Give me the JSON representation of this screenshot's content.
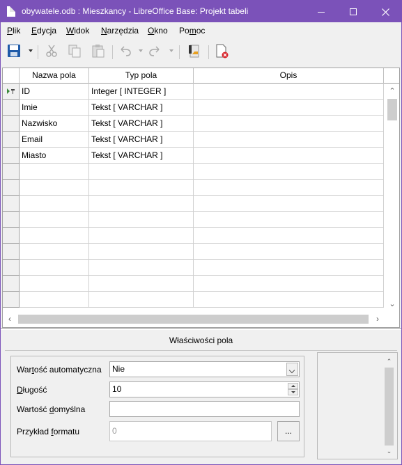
{
  "window": {
    "title": "obywatele.odb : Mieszkancy - LibreOffice Base: Projekt tabeli",
    "accent_color": "#7b52b9"
  },
  "menu": [
    {
      "label": "Plik",
      "ul": "P",
      "rest": "lik"
    },
    {
      "label": "Edycja",
      "ul": "E",
      "rest": "dycja"
    },
    {
      "label": "Widok",
      "ul": "W",
      "rest": "idok"
    },
    {
      "label": "Narzędzia",
      "ul": "N",
      "rest": "arzędzia"
    },
    {
      "label": "Okno",
      "ul": "O",
      "rest": "kno"
    },
    {
      "label": "Pomoc",
      "pre": "Po",
      "ul": "m",
      "rest": "oc"
    }
  ],
  "toolbar": {
    "icons": [
      "save-icon",
      "cut-icon",
      "copy-icon",
      "paste-icon",
      "undo-icon",
      "redo-icon",
      "primary-key-icon",
      "index-design-icon"
    ]
  },
  "grid": {
    "headers": [
      "Nazwa pola",
      "Typ pola",
      "Opis"
    ],
    "rows": [
      {
        "name": "ID",
        "type": "Integer [ INTEGER ]",
        "desc": "",
        "primary_key": true
      },
      {
        "name": "Imie",
        "type": "Tekst [ VARCHAR ]",
        "desc": ""
      },
      {
        "name": "Nazwisko",
        "type": "Tekst [ VARCHAR ]",
        "desc": ""
      },
      {
        "name": "Email",
        "type": "Tekst [ VARCHAR ]",
        "desc": ""
      },
      {
        "name": "Miasto",
        "type": "Tekst [ VARCHAR ]",
        "desc": ""
      }
    ],
    "empty_rows": 9
  },
  "properties": {
    "title": "Właściwości pola",
    "auto_value": {
      "pre": "War",
      "ul": "t",
      "rest": "ość automatyczna",
      "value": "Nie"
    },
    "length": {
      "pre": "",
      "ul": "D",
      "rest": "ługość",
      "value": "10"
    },
    "default_value": {
      "pre": "Wartość ",
      "ul": "d",
      "rest": "omyślna",
      "value": ""
    },
    "format_example": {
      "pre": "Przykład ",
      "ul": "f",
      "rest": "ormatu",
      "value": "0",
      "button": "..."
    }
  }
}
